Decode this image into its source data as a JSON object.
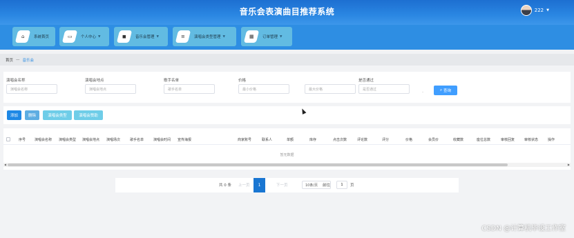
{
  "header": {
    "title": "音乐会表演曲目推荐系统",
    "user_name": "222"
  },
  "nav": [
    {
      "label": "系统首页",
      "icon": "home-icon",
      "has_dropdown": false
    },
    {
      "label": "个人中心",
      "icon": "window-icon",
      "has_dropdown": true
    },
    {
      "label": "音乐会管理",
      "icon": "bag-icon",
      "has_dropdown": true
    },
    {
      "label": "演唱会类型管理",
      "icon": "menu-icon",
      "has_dropdown": true
    },
    {
      "label": "订单管理",
      "icon": "grid-icon",
      "has_dropdown": true
    }
  ],
  "breadcrumb": {
    "home": "首页",
    "separator": "—",
    "current": "音乐会"
  },
  "search": {
    "fields": [
      {
        "label": "演唱会名称",
        "placeholder": "演唱会名称"
      },
      {
        "label": "演唱会地点",
        "placeholder": "演唱会地点"
      },
      {
        "label": "歌手名单",
        "placeholder": "歌手名单"
      },
      {
        "label": "价格",
        "placeholder": "最小价格"
      },
      {
        "label": "",
        "placeholder": "最大价格"
      },
      {
        "label": "是否通过",
        "placeholder": "是否通过"
      }
    ],
    "range_separator": "-",
    "button": "查询"
  },
  "actions": [
    {
      "label": "添加",
      "color": "#1e88e5"
    },
    {
      "label": "删除",
      "color": "#5dade2"
    },
    {
      "label": "演唱会类型",
      "color": "#6fcde8"
    },
    {
      "label": "演唱会赞助",
      "color": "#6fcde8"
    }
  ],
  "table": {
    "columns": [
      "序号",
      "演唱会名称",
      "演唱会类型",
      "演唱会地点",
      "演唱场次",
      "歌手名单",
      "演唱会时间",
      "宣传海报",
      "商家账号",
      "联系人",
      "单额",
      "库存",
      "点击次数",
      "评论数",
      "评分",
      "价格",
      "会员价",
      "收藏数",
      "座位总数",
      "审核回复",
      "审核状态",
      "操作"
    ],
    "empty_text": "暂无数据"
  },
  "pagination": {
    "total": "共 0 条",
    "prev": "上一页",
    "current_page": "1",
    "next": "下一页",
    "page_size": "10条/页",
    "goto_label": "前往",
    "goto_value": "1",
    "page_suffix": "页"
  },
  "watermark": "CSDN @计算机毕设工作室",
  "colors": {
    "header": "#2a86e2",
    "nav_item": "#62bbe2",
    "primary": "#409eff",
    "page_active": "#1976d2"
  }
}
